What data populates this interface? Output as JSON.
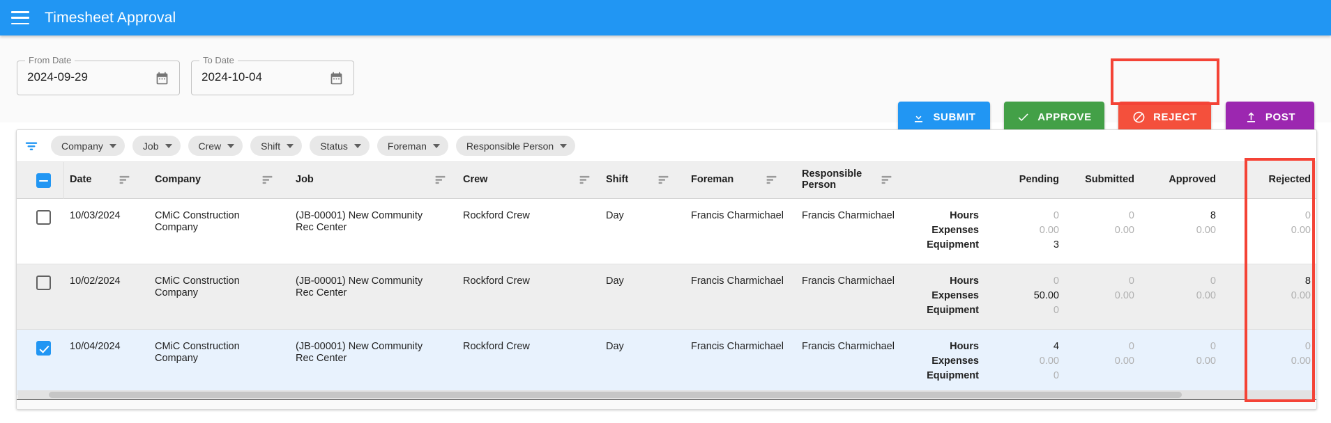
{
  "appbar": {
    "menu_icon": "hamburger-icon",
    "title": "Timesheet Approval"
  },
  "filters": {
    "from_date": {
      "label": "From Date",
      "value": "2024-09-29",
      "icon": "calendar-icon"
    },
    "to_date": {
      "label": "To Date",
      "value": "2024-10-04",
      "icon": "calendar-icon"
    }
  },
  "actions": [
    {
      "label": "SUBMIT",
      "icon": "download-icon",
      "color": "#2196f3"
    },
    {
      "label": "APPROVE",
      "icon": "check-icon",
      "color": "#43a047"
    },
    {
      "label": "REJECT",
      "icon": "block-icon",
      "color": "#f4503c",
      "highlighted": true
    },
    {
      "label": "POST",
      "icon": "upload-icon",
      "color": "#9c27b0"
    }
  ],
  "chips": [
    {
      "label": "Company"
    },
    {
      "label": "Job"
    },
    {
      "label": "Crew"
    },
    {
      "label": "Shift"
    },
    {
      "label": "Status"
    },
    {
      "label": "Foreman"
    },
    {
      "label": "Responsible Person"
    }
  ],
  "filter_icon": "filter-funnel-icon",
  "table": {
    "select_all_state": "indeterminate",
    "columns": [
      {
        "key": "date",
        "label": "Date",
        "has_filter": true
      },
      {
        "key": "company",
        "label": "Company",
        "has_filter": true
      },
      {
        "key": "job",
        "label": "Job",
        "has_filter": true
      },
      {
        "key": "crew",
        "label": "Crew",
        "has_filter": true
      },
      {
        "key": "shift",
        "label": "Shift",
        "has_filter": true
      },
      {
        "key": "foreman",
        "label": "Foreman",
        "has_filter": true
      },
      {
        "key": "responsible_person",
        "label": "Responsible Person",
        "has_filter": true
      }
    ],
    "metric_columns": [
      {
        "key": "pending",
        "label": "Pending"
      },
      {
        "key": "submitted",
        "label": "Submitted"
      },
      {
        "key": "approved",
        "label": "Approved"
      },
      {
        "key": "rejected",
        "label": "Rejected",
        "highlighted": true
      }
    ],
    "metric_rows": [
      "Hours",
      "Expenses",
      "Equipment"
    ],
    "rows": [
      {
        "selected": false,
        "date": "10/03/2024",
        "company": "CMiC Construction Company",
        "job": "(JB-00001) New Community Rec Center",
        "crew": "Rockford Crew",
        "shift": "Day",
        "foreman": "Francis Charmichael",
        "responsible_person": "Francis Charmichael",
        "pending": {
          "hours": "0",
          "expenses": "0.00",
          "equipment": "3"
        },
        "submitted": {
          "hours": "0",
          "expenses": "0.00",
          "equipment": ""
        },
        "approved": {
          "hours": "8",
          "expenses": "0.00",
          "equipment": ""
        },
        "rejected": {
          "hours": "0",
          "expenses": "0.00",
          "equipment": ""
        }
      },
      {
        "selected": false,
        "date": "10/02/2024",
        "company": "CMiC Construction Company",
        "job": "(JB-00001) New Community Rec Center",
        "crew": "Rockford Crew",
        "shift": "Day",
        "foreman": "Francis Charmichael",
        "responsible_person": "Francis Charmichael",
        "pending": {
          "hours": "0",
          "expenses": "50.00",
          "equipment": "0"
        },
        "submitted": {
          "hours": "0",
          "expenses": "0.00",
          "equipment": ""
        },
        "approved": {
          "hours": "0",
          "expenses": "0.00",
          "equipment": ""
        },
        "rejected": {
          "hours": "8",
          "expenses": "0.00",
          "equipment": ""
        }
      },
      {
        "selected": true,
        "date": "10/04/2024",
        "company": "CMiC Construction Company",
        "job": "(JB-00001) New Community Rec Center",
        "crew": "Rockford Crew",
        "shift": "Day",
        "foreman": "Francis Charmichael",
        "responsible_person": "Francis Charmichael",
        "pending": {
          "hours": "4",
          "expenses": "0.00",
          "equipment": "0"
        },
        "submitted": {
          "hours": "0",
          "expenses": "0.00",
          "equipment": ""
        },
        "approved": {
          "hours": "0",
          "expenses": "0.00",
          "equipment": ""
        },
        "rejected": {
          "hours": "0",
          "expenses": "0.00",
          "equipment": ""
        }
      }
    ]
  }
}
